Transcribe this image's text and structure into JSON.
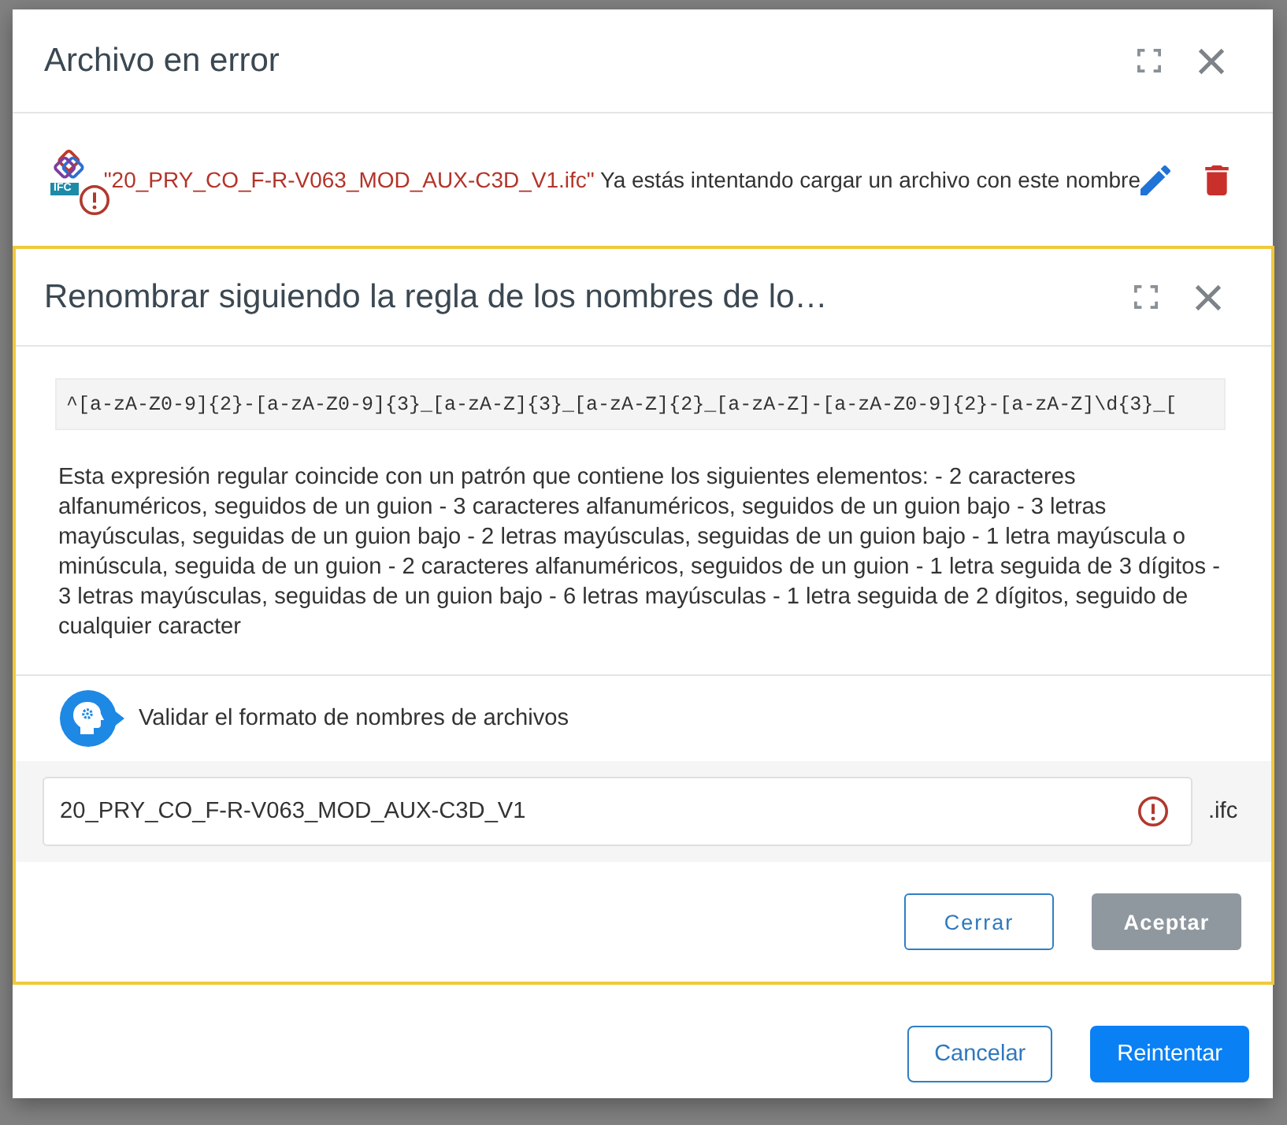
{
  "dialog": {
    "title": "Archivo en error"
  },
  "files": [
    {
      "name": "\"20_PRY_CO_F-R-V063_MOD_AUX-C3D_V1.ifc\"",
      "message": "Ya estás intentando cargar un archivo con este nombre",
      "type_label": "IFC",
      "error": true
    }
  ],
  "rename_dialog": {
    "title": "Renombrar siguiendo la regla de los nombres de lo…",
    "pattern": "^[a-zA-Z0-9]{2}-[a-zA-Z0-9]{3}_[a-zA-Z]{3}_[a-zA-Z]{2}_[a-zA-Z]-[a-zA-Z0-9]{2}-[a-zA-Z]\\d{3}_[",
    "description": "Esta expresión regular coincide con un patrón que contiene los siguientes elementos: - 2 caracteres alfanuméricos, seguidos de un guion - 3 caracteres alfanuméricos, seguidos de un guion bajo - 3 letras mayúsculas, seguidas de un guion bajo - 2 letras mayúsculas, seguidas de un guion bajo - 1 letra mayúscula o minúscula, seguida de un guion - 2 caracteres alfanuméricos, seguidos de un guion - 1 letra seguida de 3 dígitos - 3 letras mayúsculas, seguidas de un guion bajo - 6 letras mayúsculas - 1 letra seguida de 2 dígitos, seguido de cualquier caracter",
    "validate_label": "Validar el formato de nombres de archivos",
    "filename": {
      "value": "20_PRY_CO_F-R-V063_MOD_AUX-C3D_V1",
      "error": true
    },
    "extension": ".ifc",
    "buttons": [
      {
        "label": "Cerrar",
        "kind": "secondary",
        "disabled": false
      },
      {
        "label": "Aceptar",
        "kind": "primary",
        "disabled": true
      }
    ]
  },
  "buttons": [
    {
      "label": "Cancelar",
      "kind": "secondary",
      "disabled": false
    },
    {
      "label": "Reintentar",
      "kind": "primary",
      "disabled": false
    }
  ]
}
